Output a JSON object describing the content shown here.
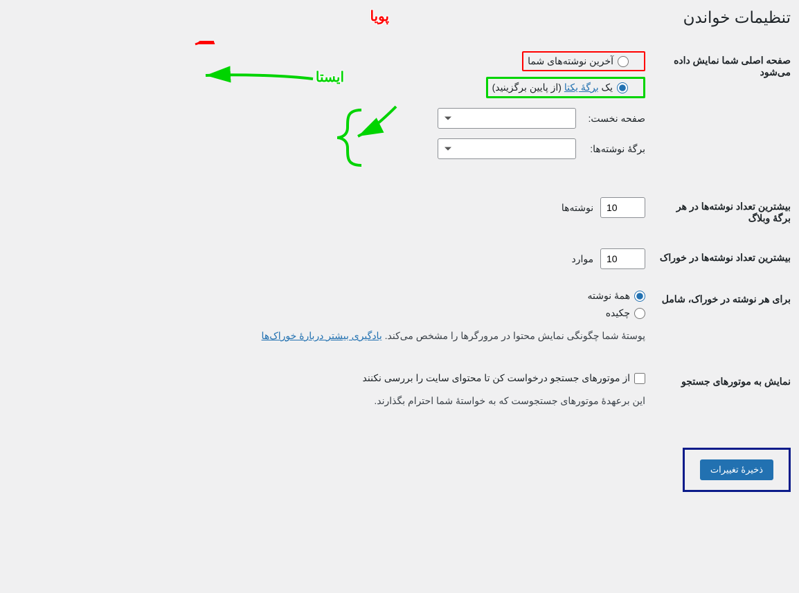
{
  "page_title": "تنظیمات خواندن",
  "homepage": {
    "heading": "صفحه اصلی شما نمایش داده می‌شود",
    "opt_latest": "آخرین نوشته‌های شما",
    "opt_static_prefix": "یک ",
    "opt_static_link": "برگهٔ یکتا",
    "opt_static_suffix": " (از پایین برگزینید)",
    "front_label": "صفحه نخست:",
    "posts_label": "برگهٔ نوشته‌ها:"
  },
  "blog_count": {
    "heading": "بیشترین تعداد نوشته‌ها در هر برگهٔ وبلاگ",
    "value": "10",
    "suffix": "نوشته‌ها"
  },
  "feed_count": {
    "heading": "بیشترین تعداد نوشته‌ها در خوراک",
    "value": "10",
    "suffix": "موارد"
  },
  "feed_content": {
    "heading": "برای هر نوشته در خوراک، شامل",
    "opt_full": "همهٔ نوشته",
    "opt_excerpt": "چکیده",
    "note_text": "پوستهٔ شما چگونگی نمایش محتوا در مرورگرها را مشخص می‌کند. ",
    "note_link": "یادگیری بیشتر دربارهٔ خوراک‌ها"
  },
  "search_engines": {
    "heading": "نمایش به موتورهای جستجو",
    "checkbox_label": "از موتورهای جستجو درخواست کن تا محتوای سایت را بررسی نکنند",
    "note": "این برعهدهٔ موتورهای جستجوست که به خواستهٔ شما احترام بگذارند."
  },
  "submit_label": "ذخیرهٔ تغییرات",
  "annotations": {
    "dynamic": "پویا",
    "static": "ایستا"
  }
}
